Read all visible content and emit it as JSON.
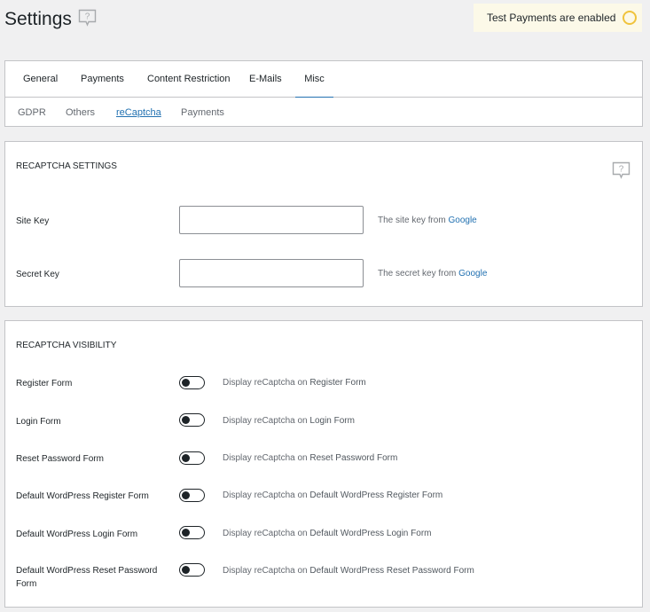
{
  "page": {
    "title": "Settings"
  },
  "notice": {
    "test_payments": "Test Payments are enabled",
    "ring_color": "#f0c33c"
  },
  "tabs": [
    {
      "label": "General",
      "active": false
    },
    {
      "label": "Payments",
      "active": false
    },
    {
      "label": "Content Restriction",
      "active": false
    },
    {
      "label": "E-Mails",
      "active": false
    },
    {
      "label": "Misc",
      "active": true
    }
  ],
  "subtabs": [
    {
      "label": "GDPR",
      "active": false
    },
    {
      "label": "Others",
      "active": false
    },
    {
      "label": "reCaptcha",
      "active": true
    },
    {
      "label": "Payments",
      "active": false
    }
  ],
  "recaptcha_settings": {
    "title": "RECAPTCHA SETTINGS",
    "site_key": {
      "label": "Site Key",
      "value": "",
      "help_prefix": "The site key from",
      "help_link": "Google"
    },
    "secret_key": {
      "label": "Secret Key",
      "value": "",
      "help_prefix": "The secret key from",
      "help_link": "Google"
    }
  },
  "recaptcha_visibility": {
    "title": "RECAPTCHA VISIBILITY",
    "help_prefix": "Display reCaptcha on",
    "items": [
      {
        "label": "Register Form",
        "target": "Register Form",
        "enabled": false
      },
      {
        "label": "Login Form",
        "target": "Login Form",
        "enabled": false
      },
      {
        "label": "Reset Password Form",
        "target": "Reset Password Form",
        "enabled": false
      },
      {
        "label": "Default WordPress Register Form",
        "target": "Default WordPress Register Form",
        "enabled": false
      },
      {
        "label": "Default WordPress Login Form",
        "target": "Default WordPress Login Form",
        "enabled": false
      },
      {
        "label": "Default WordPress Reset Password Form",
        "target": "Default WordPress Reset Password Form",
        "enabled": false
      }
    ]
  },
  "colors": {
    "accent": "#2271b1",
    "border": "#c3c4c7",
    "background": "#f0f0f1"
  }
}
